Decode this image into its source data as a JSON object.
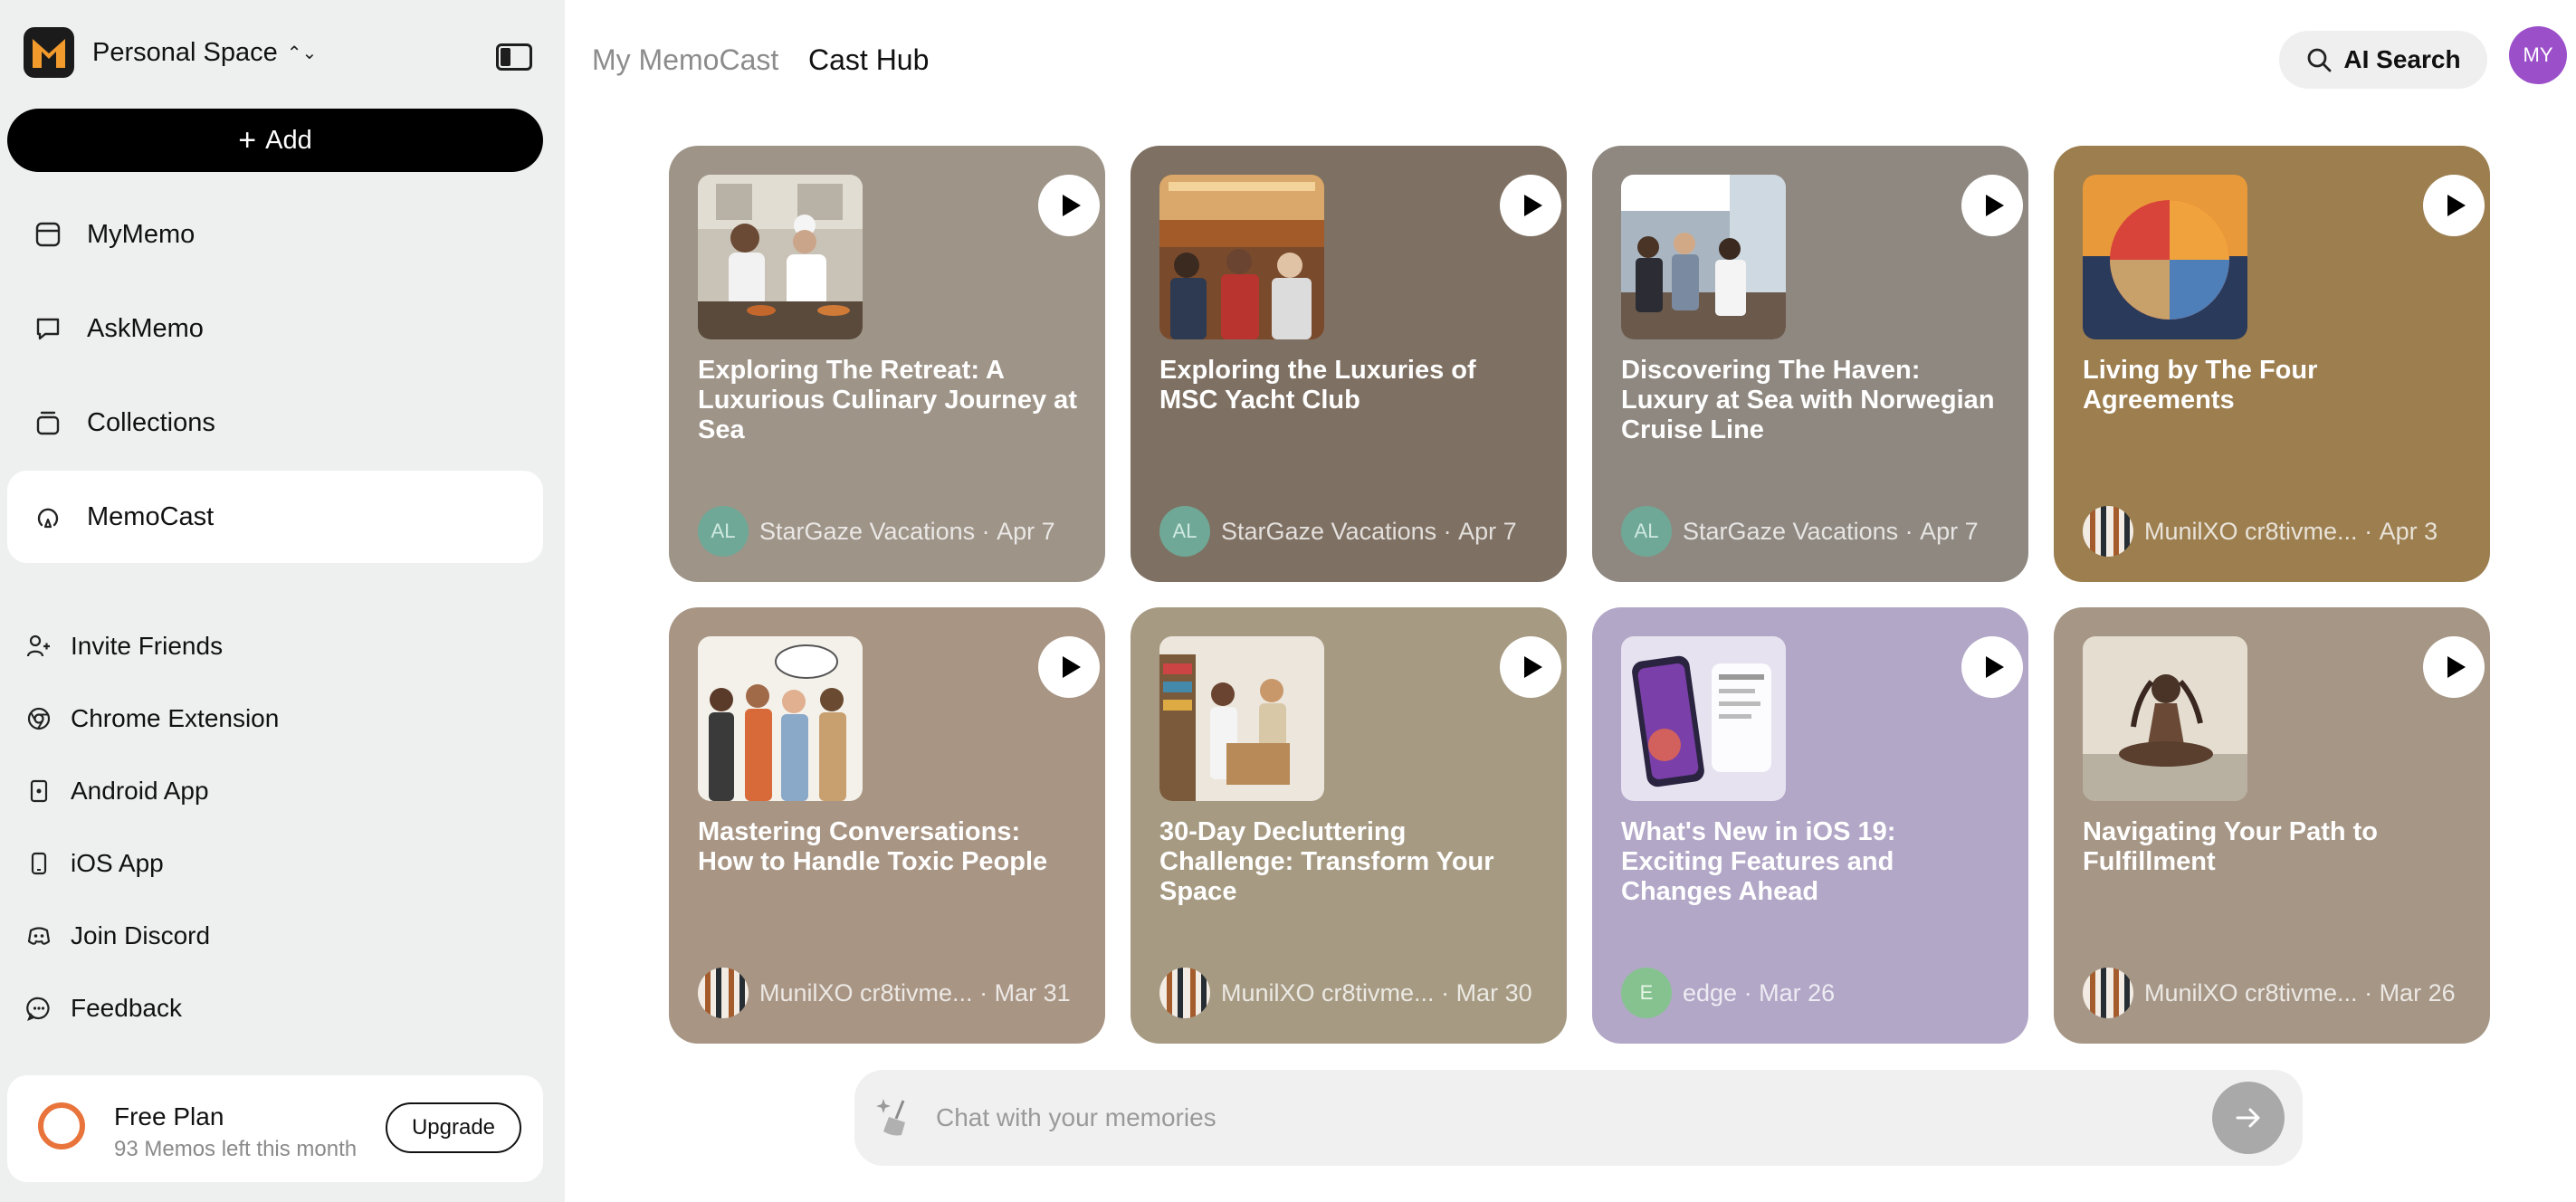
{
  "sidebar": {
    "space_name": "Personal Space",
    "add_label": "Add",
    "nav": [
      {
        "label": "MyMemo",
        "icon": "memo-icon"
      },
      {
        "label": "AskMemo",
        "icon": "chat-bubble-icon"
      },
      {
        "label": "Collections",
        "icon": "collections-icon"
      },
      {
        "label": "MemoCast",
        "icon": "podcast-icon",
        "active": true
      }
    ],
    "links": [
      {
        "label": "Invite Friends",
        "icon": "invite-icon"
      },
      {
        "label": "Chrome Extension",
        "icon": "chrome-icon"
      },
      {
        "label": "Android App",
        "icon": "android-icon"
      },
      {
        "label": "iOS App",
        "icon": "phone-icon"
      },
      {
        "label": "Join Discord",
        "icon": "discord-icon"
      },
      {
        "label": "Feedback",
        "icon": "feedback-icon"
      }
    ],
    "plan": {
      "title": "Free Plan",
      "subtitle": "93 Memos left this month",
      "upgrade_label": "Upgrade"
    }
  },
  "header": {
    "tabs": [
      {
        "label": "My MemoCast"
      },
      {
        "label": "Cast Hub",
        "active": true
      }
    ],
    "ai_search_label": "AI Search",
    "user_initials": "MY"
  },
  "cards": [
    {
      "title": "Exploring The Retreat: A Luxurious Culinary Journey at Sea",
      "author_initials": "AL",
      "author": "StarGaze Vacations",
      "date": "Apr 7",
      "bg": "#9e9488"
    },
    {
      "title": "Exploring the Luxuries of MSC Yacht Club",
      "author_initials": "AL",
      "author": "StarGaze Vacations",
      "date": "Apr 7",
      "bg": "#7e7062"
    },
    {
      "title": "Discovering The Haven: Luxury at Sea with Norwegian Cruise Line",
      "author_initials": "AL",
      "author": "StarGaze Vacations",
      "date": "Apr 7",
      "bg": "#8f8880"
    },
    {
      "title": "Living by The Four Agreements",
      "author_initials": "",
      "author": "MunilXO cr8tivme...",
      "date": "Apr 3",
      "bg": "#9c7e4f"
    },
    {
      "title": "Mastering Conversations: How to Handle Toxic People",
      "author_initials": "",
      "author": "MunilXO cr8tivme...",
      "date": "Mar 31",
      "bg": "#a89584"
    },
    {
      "title": "30-Day Decluttering Challenge: Transform Your Space",
      "author_initials": "",
      "author": "MunilXO cr8tivme...",
      "date": "Mar 30",
      "bg": "#a69a82"
    },
    {
      "title": "What's New in iOS 19: Exciting Features and Changes Ahead",
      "author_initials": "E",
      "author": "edge",
      "date": "Mar 26",
      "bg": "#b2a7c7"
    },
    {
      "title": "Navigating Your Path to Fulfillment",
      "author_initials": "",
      "author": "MunilXO cr8tivme...",
      "date": "Mar 26",
      "bg": "#a69685"
    }
  ],
  "chat": {
    "placeholder": "Chat with your memories"
  }
}
